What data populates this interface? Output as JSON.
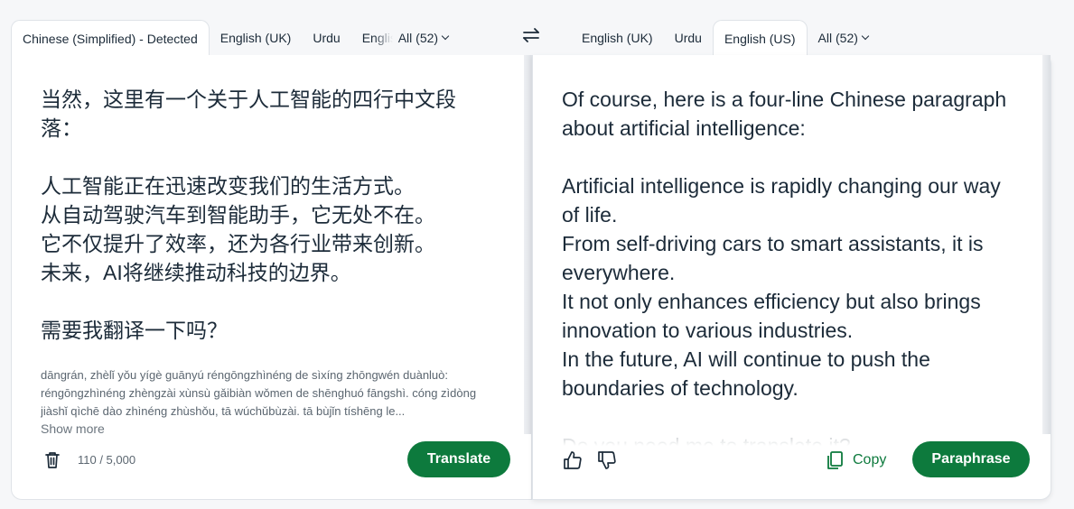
{
  "source_tabs": [
    {
      "label": "Chinese (Simplified) - Detected",
      "active": true
    },
    {
      "label": "English (UK)",
      "active": false
    },
    {
      "label": "Urdu",
      "active": false
    },
    {
      "label": "English",
      "active": false
    },
    {
      "label": "All (52)",
      "active": false
    }
  ],
  "target_tabs": [
    {
      "label": "English (UK)",
      "active": false
    },
    {
      "label": "Urdu",
      "active": false
    },
    {
      "label": "English (US)",
      "active": true
    },
    {
      "label": "All (52)",
      "active": false
    }
  ],
  "source": {
    "text": "当然，这里有一个关于人工智能的四行中文段落：\n\n人工智能正在迅速改变我们的生活方式。\n从自动驾驶汽车到智能助手，它无处不在。\n它不仅提升了效率，还为各行业带来创新。\n未来，AI将继续推动科技的边界。\n\n需要我翻译一下吗？",
    "transliteration": "dāngrán, zhèlǐ yǒu yígè guānyú réngōngzhìnéng de sìxíng zhōngwén duànluò: réngōngzhìnéng zhèngzài xùnsù gǎibiàn wǒmen de shēnghuó fāngshì. cóng zìdòng jiàshǐ qìchē dào zhìnéng zhùshǒu, tā wúchǔbùzài. tā bùjǐn tíshēng le...",
    "show_more": "Show more",
    "char_count": "110 / 5,000",
    "translate_label": "Translate"
  },
  "target": {
    "text": "Of course, here is a four-line Chinese paragraph about artificial intelligence:\n\nArtificial intelligence is rapidly changing our way of life.\nFrom self-driving cars to smart assistants, it is everywhere.\nIt not only enhances efficiency but also brings innovation to various industries.\nIn the future, AI will continue to push the boundaries of technology.\n\nDo you need me to translate it?",
    "copy_label": "Copy",
    "paraphrase_label": "Paraphrase"
  },
  "icons": {
    "swap": "swap-arrows-icon",
    "trash": "trash-icon",
    "thumbs_up": "thumbs-up-icon",
    "thumbs_down": "thumbs-down-icon",
    "copy": "copy-icon"
  },
  "colors": {
    "accent": "#0d7a3d",
    "text": "#1c2b39",
    "muted": "#5b6670"
  }
}
